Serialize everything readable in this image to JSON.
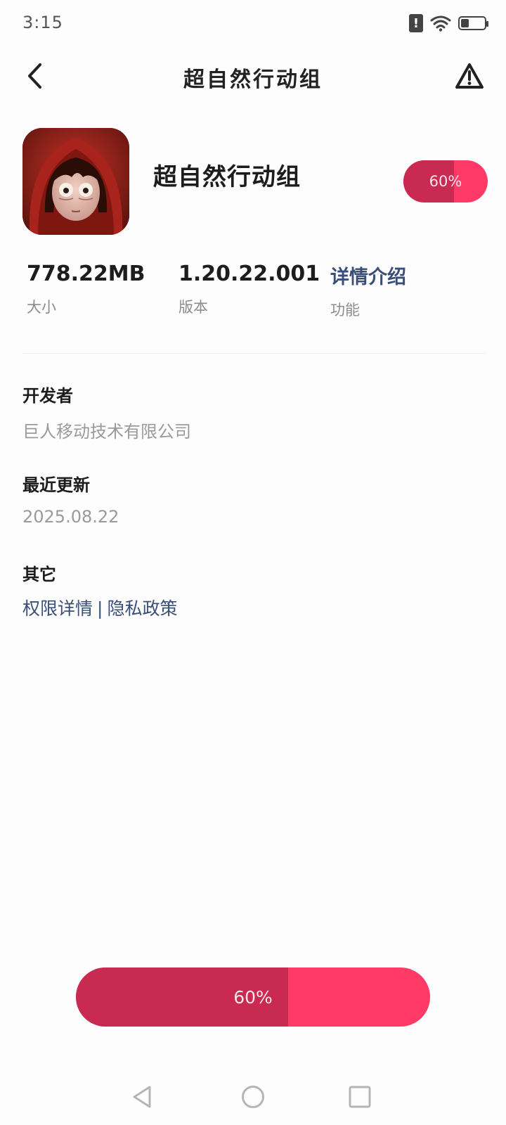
{
  "status_bar": {
    "time": "3:15",
    "battery_level": 0.35,
    "icons": [
      "alert-badge-icon",
      "wifi-icon",
      "battery-icon"
    ]
  },
  "nav": {
    "title": "超自然行动组",
    "back_icon": "back-arrow-icon",
    "report_icon": "warning-triangle-icon"
  },
  "app": {
    "name": "超自然行动组",
    "icon": "app-icon-red-hood-girl",
    "download_progress": 0.6,
    "progress_label": "60%"
  },
  "stats": [
    {
      "value": "778.22MB",
      "label": "大小"
    },
    {
      "value": "1.20.22.001",
      "label": "版本"
    },
    {
      "value": "详情介绍",
      "label": "功能"
    }
  ],
  "developer": {
    "title": "开发者",
    "value": "巨人移动技术有限公司"
  },
  "update": {
    "title": "最近更新",
    "value": "2025.08.22"
  },
  "other": {
    "title": "其它",
    "permissions_link": "权限详情",
    "separator": "|",
    "privacy_link": "隐私政策"
  },
  "main_button": {
    "progress": 0.6,
    "label": "60%"
  },
  "system_nav": {
    "icons": [
      "back-triangle-icon",
      "home-circle-icon",
      "recents-square-icon"
    ]
  },
  "colors": {
    "accent": "#ff3a66",
    "accent_dark": "#c92a52",
    "link": "#3a4f78",
    "muted_text": "#9a9a9a"
  }
}
